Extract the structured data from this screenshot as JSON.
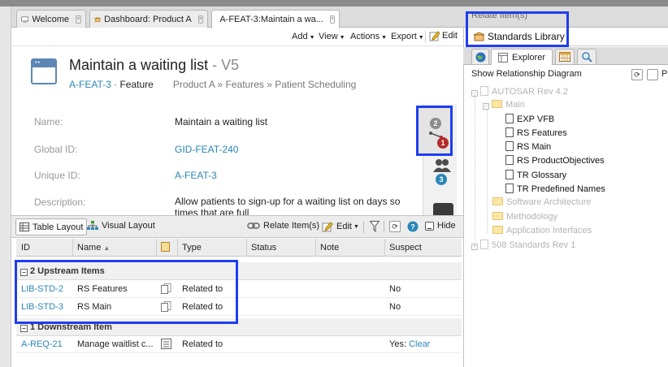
{
  "tabs": [
    {
      "label": "Welcome"
    },
    {
      "label": "Dashboard: Product A"
    },
    {
      "label": "A-FEAT-3:Maintain a wa..."
    }
  ],
  "toolbar": {
    "add": "Add",
    "view": "View",
    "actions": "Actions",
    "export": "Export",
    "edit": "Edit"
  },
  "item": {
    "title": "Maintain a waiting list",
    "version": " - V5",
    "id": "A-FEAT-3",
    "dot": " · ",
    "type": "Feature",
    "breadcrumb": "Product A » Features » Patient Scheduling"
  },
  "fields": [
    {
      "label": "Name:",
      "value": "Maintain a waiting list"
    },
    {
      "label": "Global ID:",
      "value": "GID-FEAT-240"
    },
    {
      "label": "Unique ID:",
      "value": "A-FEAT-3"
    },
    {
      "label": "Description:",
      "value": "Allow patients to sign-up for a waiting list on days so times that are full"
    }
  ],
  "side": {
    "upstream_badge": "2",
    "downstream_badge": "1",
    "people_badge": "3"
  },
  "bottom_toolbar": {
    "table_layout": "Table Layout",
    "visual_layout": "Visual Layout",
    "relate": "Relate Item(s)",
    "edit": "Edit",
    "hide": "Hide"
  },
  "table": {
    "headers": [
      "ID",
      "Name",
      "Type",
      "Status",
      "Note",
      "Suspect"
    ],
    "upstream_label": "2 Upstream Items",
    "downstream_label": "1 Downstream Item",
    "upstream": [
      {
        "id": "LIB-STD-2",
        "name": "RS Features",
        "type": "Related to",
        "suspect": "No"
      },
      {
        "id": "LIB-STD-3",
        "name": "RS Main",
        "type": "Related to",
        "suspect": "No"
      }
    ],
    "downstream": [
      {
        "id": "A-REQ-21",
        "name": "Manage waitlist c...",
        "type": "Related to",
        "suspect": "Yes: ",
        "clear": "Clear"
      }
    ]
  },
  "right_panel": {
    "title": "Relate Item(s)",
    "library": "Standards Library",
    "explorer_tab": "Explorer",
    "show_diagram": "Show Relationship Diagram",
    "tree": {
      "autosar": "AUTOSAR Rev 4.2",
      "main": "Main",
      "children": [
        "EXP VFB",
        "RS Features",
        "RS Main",
        "RS ProductObjectives",
        "TR Glossary",
        "TR Predefined Names"
      ],
      "software_architecture": "Software Architecture",
      "methodology": "Methodology",
      "application_interfaces": "Application Interfaces",
      "standards_508": "508 Standards Rev 1"
    }
  },
  "colors": {
    "link": "#2a86b6",
    "highlight": "#1e3ef0",
    "accent": "#5c86b4"
  }
}
